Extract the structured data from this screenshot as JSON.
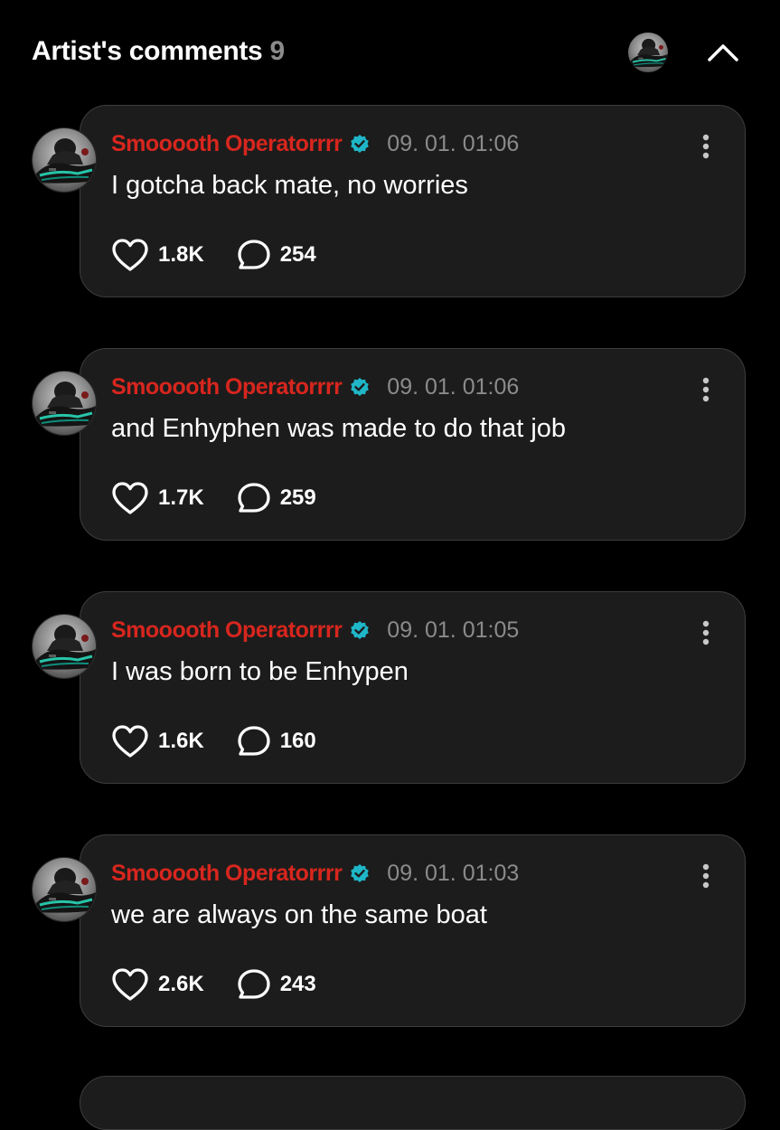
{
  "header": {
    "title": "Artist's comments",
    "count": "9",
    "avatar_icon": "artist-avatar",
    "collapse_icon": "chevron-up-icon"
  },
  "colors": {
    "background": "#000000",
    "card": "#1c1c1c",
    "card_border": "#3d3d3d",
    "author": "#d7261e",
    "verified": "#1fb6c8",
    "muted": "#8b8b8b"
  },
  "comments": [
    {
      "author": "Smooooth Operatorrrr",
      "time": "09. 01. 01:06",
      "text": "I gotcha back mate, no worries",
      "likes": "1.8K",
      "replies": "254"
    },
    {
      "author": "Smooooth Operatorrrr",
      "time": "09. 01. 01:06",
      "text": "and Enhyphen was made to do that job",
      "likes": "1.7K",
      "replies": "259"
    },
    {
      "author": "Smooooth Operatorrrr",
      "time": "09. 01. 01:05",
      "text": "I was born to be Enhypen",
      "likes": "1.6K",
      "replies": "160"
    },
    {
      "author": "Smooooth Operatorrrr",
      "time": "09. 01. 01:03",
      "text": "we are always on the same boat",
      "likes": "2.6K",
      "replies": "243"
    }
  ]
}
